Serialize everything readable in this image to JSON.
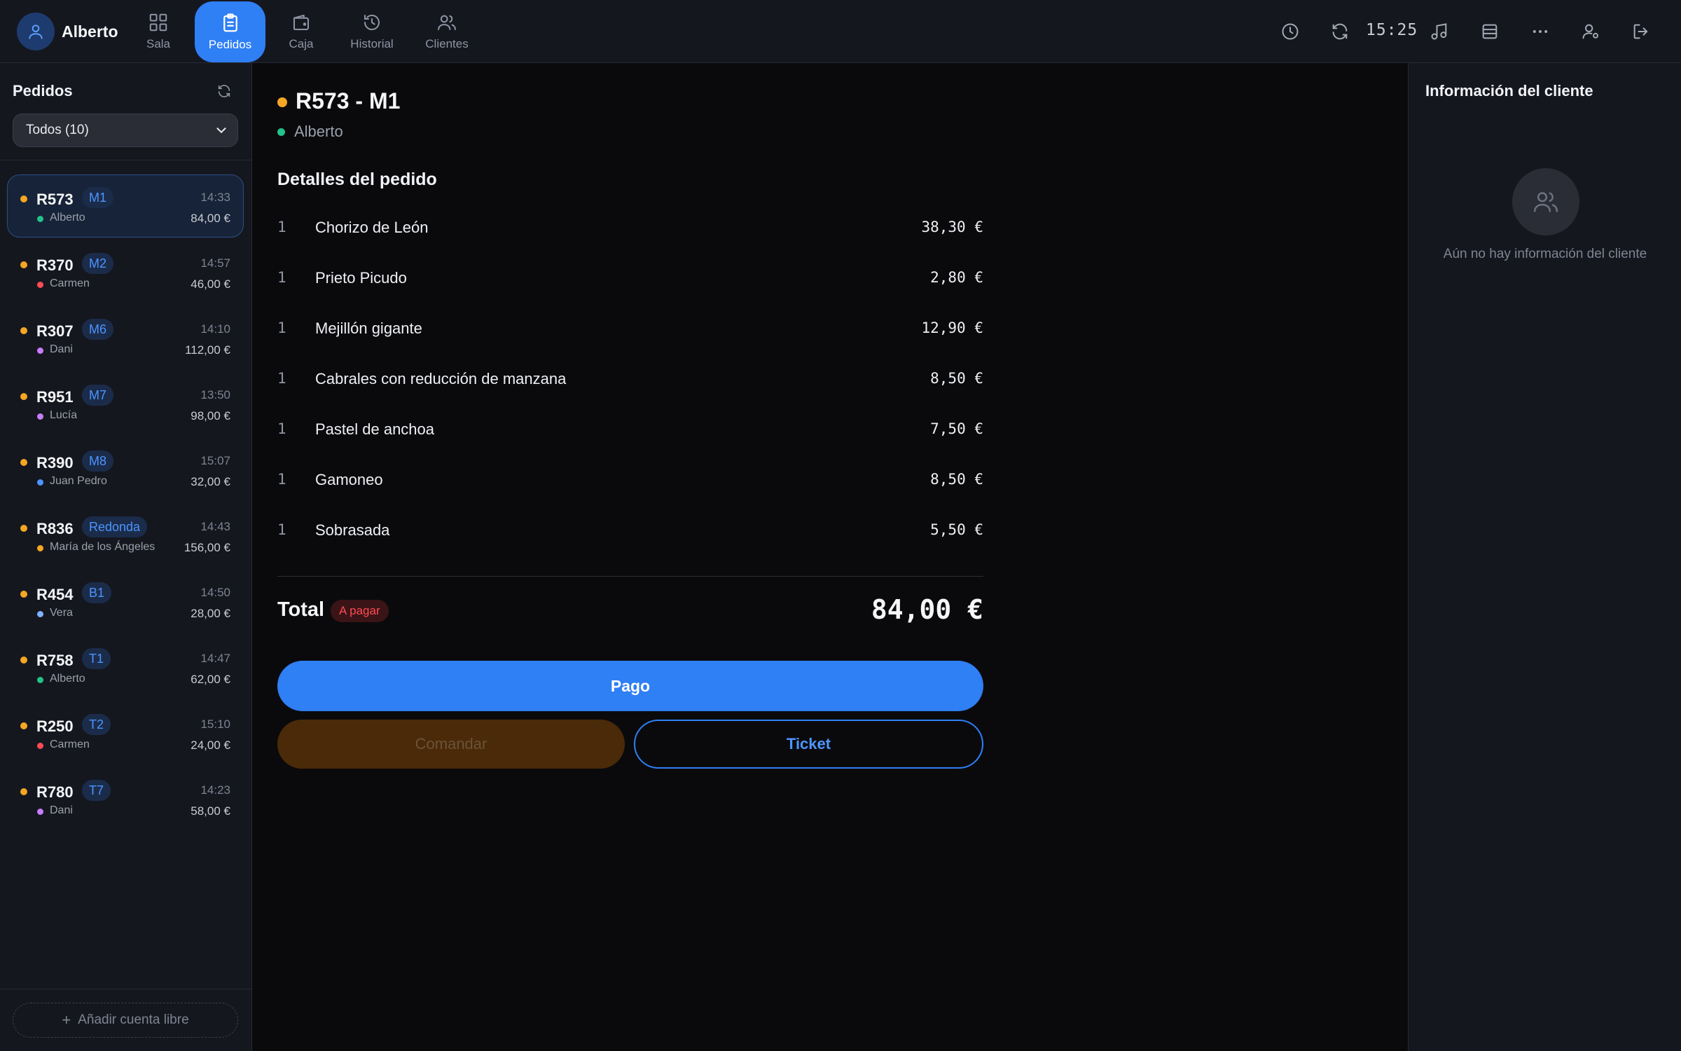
{
  "header": {
    "user_name": "Alberto",
    "clock": "15:25",
    "nav_tabs": [
      {
        "label": "Sala",
        "icon": "grid-icon"
      },
      {
        "label": "Pedidos",
        "icon": "clipboard-icon",
        "active": true
      },
      {
        "label": "Caja",
        "icon": "wallet-icon"
      },
      {
        "label": "Historial",
        "icon": "history-icon"
      },
      {
        "label": "Clientes",
        "icon": "users-icon"
      }
    ],
    "tools": [
      "clock-icon",
      "refresh-icon",
      "music-icon",
      "layers-icon",
      "more-icon",
      "user-settings-icon",
      "logout-icon"
    ]
  },
  "sidebar": {
    "title": "Pedidos",
    "filter_value": "Todos (10)",
    "add_free_label": "Añadir cuenta libre",
    "orders": [
      {
        "code": "R573",
        "table": "M1",
        "time": "14:33",
        "staff": "Alberto",
        "staff_color": "#22c28a",
        "total": "84,00 €",
        "selected": true
      },
      {
        "code": "R370",
        "table": "M2",
        "time": "14:57",
        "staff": "Carmen",
        "staff_color": "#ff4b55",
        "total": "46,00 €"
      },
      {
        "code": "R307",
        "table": "M6",
        "time": "14:10",
        "staff": "Dani",
        "staff_color": "#c77dff",
        "total": "112,00 €"
      },
      {
        "code": "R951",
        "table": "M7",
        "time": "13:50",
        "staff": "Lucía",
        "staff_color": "#c77dff",
        "total": "98,00 €"
      },
      {
        "code": "R390",
        "table": "M8",
        "time": "15:07",
        "staff": "Juan Pedro",
        "staff_color": "#4d94ff",
        "total": "32,00 €"
      },
      {
        "code": "R836",
        "table": "Redonda",
        "time": "14:43",
        "staff": "María de los Ángeles",
        "staff_color": "#f5a623",
        "total": "156,00 €"
      },
      {
        "code": "R454",
        "table": "B1",
        "time": "14:50",
        "staff": "Vera",
        "staff_color": "#7fb2ff",
        "total": "28,00 €"
      },
      {
        "code": "R758",
        "table": "T1",
        "time": "14:47",
        "staff": "Alberto",
        "staff_color": "#22c28a",
        "total": "62,00 €"
      },
      {
        "code": "R250",
        "table": "T2",
        "time": "15:10",
        "staff": "Carmen",
        "staff_color": "#ff4b55",
        "total": "24,00 €"
      },
      {
        "code": "R780",
        "table": "T7",
        "time": "14:23",
        "staff": "Dani",
        "staff_color": "#c77dff",
        "total": "58,00 €"
      }
    ]
  },
  "order": {
    "title": "R573 - M1",
    "waiter": "Alberto",
    "details_title": "Detalles del pedido",
    "items": [
      {
        "qty": "1",
        "name": "Chorizo de León",
        "price": "38,30 €"
      },
      {
        "qty": "1",
        "name": "Prieto Picudo",
        "price": "2,80 €"
      },
      {
        "qty": "1",
        "name": "Mejillón gigante",
        "price": "12,90 €"
      },
      {
        "qty": "1",
        "name": "Cabrales con reducción de manzana",
        "price": "8,50 €"
      },
      {
        "qty": "1",
        "name": "Pastel de anchoa",
        "price": "7,50 €"
      },
      {
        "qty": "1",
        "name": "Gamoneo",
        "price": "8,50 €"
      },
      {
        "qty": "1",
        "name": "Sobrasada",
        "price": "5,50 €"
      }
    ],
    "total_label": "Total",
    "status_badge": "A pagar",
    "total_amount": "84,00 €",
    "pay_label": "Pago",
    "send_label": "Comandar",
    "ticket_label": "Ticket"
  },
  "client": {
    "title": "Información del cliente",
    "empty_text": "Aún no hay información del cliente"
  },
  "colors": {
    "accent": "#2f7ff5",
    "pending": "#f5a623",
    "due": "#ff4b55"
  }
}
